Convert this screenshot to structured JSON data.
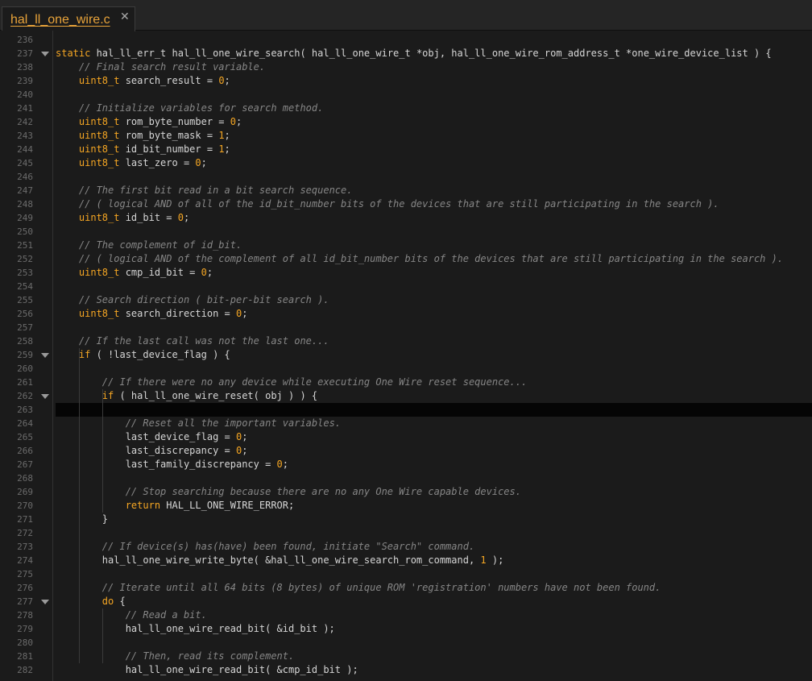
{
  "tab": {
    "title": "hal_ll_one_wire.c",
    "close_glyph": "✕"
  },
  "editor": {
    "current_line": 263,
    "lines": [
      {
        "n": "236",
        "tokens": []
      },
      {
        "n": "237",
        "fold": true,
        "tokens": [
          {
            "t": "static",
            "c": "kw"
          },
          {
            "t": " hal_ll_err_t hal_ll_one_wire_search( hal_ll_one_wire_t *obj, hal_ll_one_wire_rom_address_t *one_wire_device_list ) {"
          }
        ]
      },
      {
        "n": "238",
        "tokens": [
          {
            "t": "    "
          },
          {
            "t": "// Final search result variable.",
            "c": "cm"
          }
        ]
      },
      {
        "n": "239",
        "tokens": [
          {
            "t": "    "
          },
          {
            "t": "uint8_t",
            "c": "kw"
          },
          {
            "t": " search_result = "
          },
          {
            "t": "0",
            "c": "num"
          },
          {
            "t": ";"
          }
        ]
      },
      {
        "n": "240",
        "tokens": []
      },
      {
        "n": "241",
        "tokens": [
          {
            "t": "    "
          },
          {
            "t": "// Initialize variables for search method.",
            "c": "cm"
          }
        ]
      },
      {
        "n": "242",
        "tokens": [
          {
            "t": "    "
          },
          {
            "t": "uint8_t",
            "c": "kw"
          },
          {
            "t": " rom_byte_number = "
          },
          {
            "t": "0",
            "c": "num"
          },
          {
            "t": ";"
          }
        ]
      },
      {
        "n": "243",
        "tokens": [
          {
            "t": "    "
          },
          {
            "t": "uint8_t",
            "c": "kw"
          },
          {
            "t": " rom_byte_mask = "
          },
          {
            "t": "1",
            "c": "num"
          },
          {
            "t": ";"
          }
        ]
      },
      {
        "n": "244",
        "tokens": [
          {
            "t": "    "
          },
          {
            "t": "uint8_t",
            "c": "kw"
          },
          {
            "t": " id_bit_number = "
          },
          {
            "t": "1",
            "c": "num"
          },
          {
            "t": ";"
          }
        ]
      },
      {
        "n": "245",
        "tokens": [
          {
            "t": "    "
          },
          {
            "t": "uint8_t",
            "c": "kw"
          },
          {
            "t": " last_zero = "
          },
          {
            "t": "0",
            "c": "num"
          },
          {
            "t": ";"
          }
        ]
      },
      {
        "n": "246",
        "tokens": []
      },
      {
        "n": "247",
        "tokens": [
          {
            "t": "    "
          },
          {
            "t": "// The first bit read in a bit search sequence.",
            "c": "cm"
          }
        ]
      },
      {
        "n": "248",
        "tokens": [
          {
            "t": "    "
          },
          {
            "t": "// ( logical AND of all of the id_bit_number bits of the devices that are still participating in the search ).",
            "c": "cm"
          }
        ]
      },
      {
        "n": "249",
        "tokens": [
          {
            "t": "    "
          },
          {
            "t": "uint8_t",
            "c": "kw"
          },
          {
            "t": " id_bit = "
          },
          {
            "t": "0",
            "c": "num"
          },
          {
            "t": ";"
          }
        ]
      },
      {
        "n": "250",
        "tokens": []
      },
      {
        "n": "251",
        "tokens": [
          {
            "t": "    "
          },
          {
            "t": "// The complement of id_bit.",
            "c": "cm"
          }
        ]
      },
      {
        "n": "252",
        "tokens": [
          {
            "t": "    "
          },
          {
            "t": "// ( logical AND of the complement of all id_bit_number bits of the devices that are still participating in the search ).",
            "c": "cm"
          }
        ]
      },
      {
        "n": "253",
        "tokens": [
          {
            "t": "    "
          },
          {
            "t": "uint8_t",
            "c": "kw"
          },
          {
            "t": " cmp_id_bit = "
          },
          {
            "t": "0",
            "c": "num"
          },
          {
            "t": ";"
          }
        ]
      },
      {
        "n": "254",
        "tokens": []
      },
      {
        "n": "255",
        "tokens": [
          {
            "t": "    "
          },
          {
            "t": "// Search direction ( bit-per-bit search ).",
            "c": "cm"
          }
        ]
      },
      {
        "n": "256",
        "tokens": [
          {
            "t": "    "
          },
          {
            "t": "uint8_t",
            "c": "kw"
          },
          {
            "t": " search_direction = "
          },
          {
            "t": "0",
            "c": "num"
          },
          {
            "t": ";"
          }
        ]
      },
      {
        "n": "257",
        "tokens": []
      },
      {
        "n": "258",
        "tokens": [
          {
            "t": "    "
          },
          {
            "t": "// If the last call was not the last one...",
            "c": "cm"
          }
        ]
      },
      {
        "n": "259",
        "fold": true,
        "tokens": [
          {
            "t": "    "
          },
          {
            "t": "if",
            "c": "kw"
          },
          {
            "t": " ( !last_device_flag ) {"
          }
        ]
      },
      {
        "n": "260",
        "tokens": []
      },
      {
        "n": "261",
        "tokens": [
          {
            "t": "        "
          },
          {
            "t": "// If there were no any device while executing One Wire reset sequence...",
            "c": "cm"
          }
        ]
      },
      {
        "n": "262",
        "fold": true,
        "tokens": [
          {
            "t": "        "
          },
          {
            "t": "if",
            "c": "kw"
          },
          {
            "t": " ( hal_ll_one_wire_reset( obj ) ) {"
          }
        ]
      },
      {
        "n": "263",
        "tokens": []
      },
      {
        "n": "264",
        "tokens": [
          {
            "t": "            "
          },
          {
            "t": "// Reset all the important variables.",
            "c": "cm"
          }
        ]
      },
      {
        "n": "265",
        "tokens": [
          {
            "t": "            last_device_flag = "
          },
          {
            "t": "0",
            "c": "num"
          },
          {
            "t": ";"
          }
        ]
      },
      {
        "n": "266",
        "tokens": [
          {
            "t": "            last_discrepancy = "
          },
          {
            "t": "0",
            "c": "num"
          },
          {
            "t": ";"
          }
        ]
      },
      {
        "n": "267",
        "tokens": [
          {
            "t": "            last_family_discrepancy = "
          },
          {
            "t": "0",
            "c": "num"
          },
          {
            "t": ";"
          }
        ]
      },
      {
        "n": "268",
        "tokens": []
      },
      {
        "n": "269",
        "tokens": [
          {
            "t": "            "
          },
          {
            "t": "// Stop searching because there are no any One Wire capable devices.",
            "c": "cm"
          }
        ]
      },
      {
        "n": "270",
        "tokens": [
          {
            "t": "            "
          },
          {
            "t": "return",
            "c": "kw"
          },
          {
            "t": " HAL_LL_ONE_WIRE_ERROR;"
          }
        ]
      },
      {
        "n": "271",
        "tokens": [
          {
            "t": "        }"
          }
        ]
      },
      {
        "n": "272",
        "tokens": []
      },
      {
        "n": "273",
        "tokens": [
          {
            "t": "        "
          },
          {
            "t": "// If device(s) has(have) been found, initiate \"Search\" command.",
            "c": "cm"
          }
        ]
      },
      {
        "n": "274",
        "tokens": [
          {
            "t": "        hal_ll_one_wire_write_byte( &hal_ll_one_wire_search_rom_command, "
          },
          {
            "t": "1",
            "c": "num"
          },
          {
            "t": " );"
          }
        ]
      },
      {
        "n": "275",
        "tokens": []
      },
      {
        "n": "276",
        "tokens": [
          {
            "t": "        "
          },
          {
            "t": "// Iterate until all 64 bits (8 bytes) of unique ROM 'registration' numbers have not been found.",
            "c": "cm"
          }
        ]
      },
      {
        "n": "277",
        "fold": true,
        "tokens": [
          {
            "t": "        "
          },
          {
            "t": "do",
            "c": "kw"
          },
          {
            "t": " {"
          }
        ]
      },
      {
        "n": "278",
        "tokens": [
          {
            "t": "            "
          },
          {
            "t": "// Read a bit.",
            "c": "cm"
          }
        ]
      },
      {
        "n": "279",
        "tokens": [
          {
            "t": "            hal_ll_one_wire_read_bit( &id_bit );"
          }
        ]
      },
      {
        "n": "280",
        "tokens": []
      },
      {
        "n": "281",
        "tokens": [
          {
            "t": "            "
          },
          {
            "t": "// Then, read its complement.",
            "c": "cm"
          }
        ]
      },
      {
        "n": "282",
        "tokens": [
          {
            "t": "            hal_ll_one_wire_read_bit( &cmp_id_bit );"
          }
        ]
      }
    ]
  }
}
